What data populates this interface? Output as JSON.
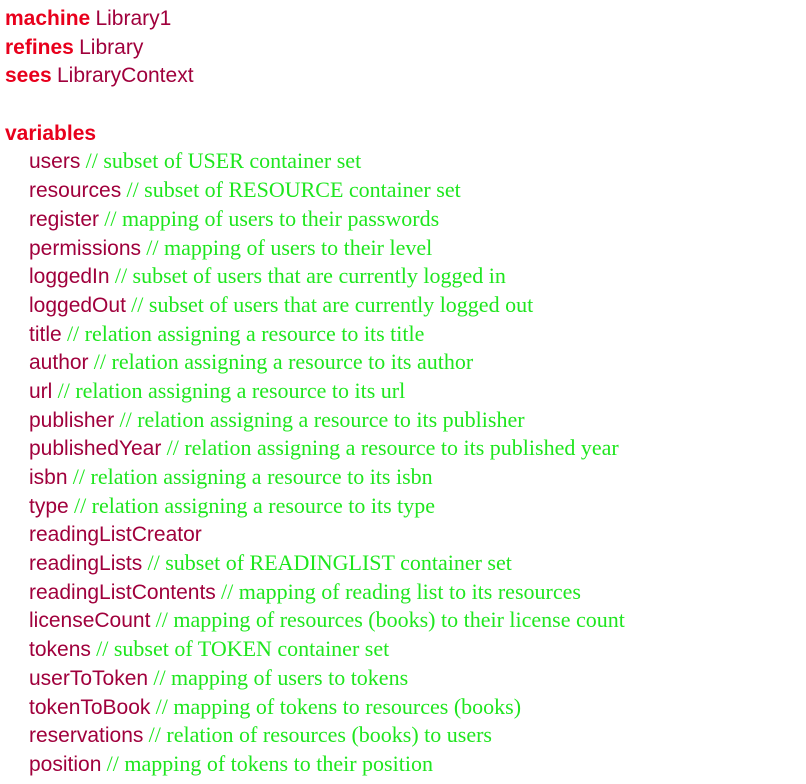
{
  "header": {
    "machine_kw": "machine",
    "machine_name": "Library1",
    "refines_kw": "refines",
    "refines_name": "Library",
    "sees_kw": "sees",
    "sees_name": "LibraryContext"
  },
  "variables_kw": "variables",
  "colors": {
    "keyword": "#e8001c",
    "identifier": "#a0003c",
    "comment": "#1ee61e"
  },
  "variables": [
    {
      "name": "users",
      "comment": "// subset of USER container set"
    },
    {
      "name": "resources",
      "comment": "// subset of RESOURCE container set"
    },
    {
      "name": "register",
      "comment": "// mapping of users to their passwords"
    },
    {
      "name": "permissions",
      "comment": "// mapping of users to their level"
    },
    {
      "name": "loggedIn",
      "comment": "// subset of users that are currently logged in"
    },
    {
      "name": "loggedOut",
      "comment": "// subset of users that are currently logged out"
    },
    {
      "name": "title",
      "comment": "// relation assigning a resource to its title"
    },
    {
      "name": "author",
      "comment": "// relation assigning a resource to its author"
    },
    {
      "name": "url",
      "comment": "// relation assigning a resource to its url"
    },
    {
      "name": "publisher",
      "comment": "// relation assigning a resource to its publisher"
    },
    {
      "name": "publishedYear",
      "comment": "// relation assigning a resource to its published year"
    },
    {
      "name": "isbn",
      "comment": "// relation assigning a resource to its isbn"
    },
    {
      "name": "type",
      "comment": "// relation assigning a resource to its type"
    },
    {
      "name": "readingListCreator",
      "comment": ""
    },
    {
      "name": "readingLists",
      "comment": "// subset of READINGLIST container set"
    },
    {
      "name": "readingListContents",
      "comment": "// mapping of reading list to its resources"
    },
    {
      "name": "licenseCount",
      "comment": "// mapping of resources (books) to their license count"
    },
    {
      "name": "tokens",
      "comment": "// subset of TOKEN container set"
    },
    {
      "name": "userToToken",
      "comment": "// mapping of users to tokens"
    },
    {
      "name": "tokenToBook",
      "comment": "// mapping of tokens to resources (books)"
    },
    {
      "name": "reservations",
      "comment": "// relation of resources (books) to users"
    },
    {
      "name": "position",
      "comment": "// mapping of tokens to their position"
    }
  ]
}
